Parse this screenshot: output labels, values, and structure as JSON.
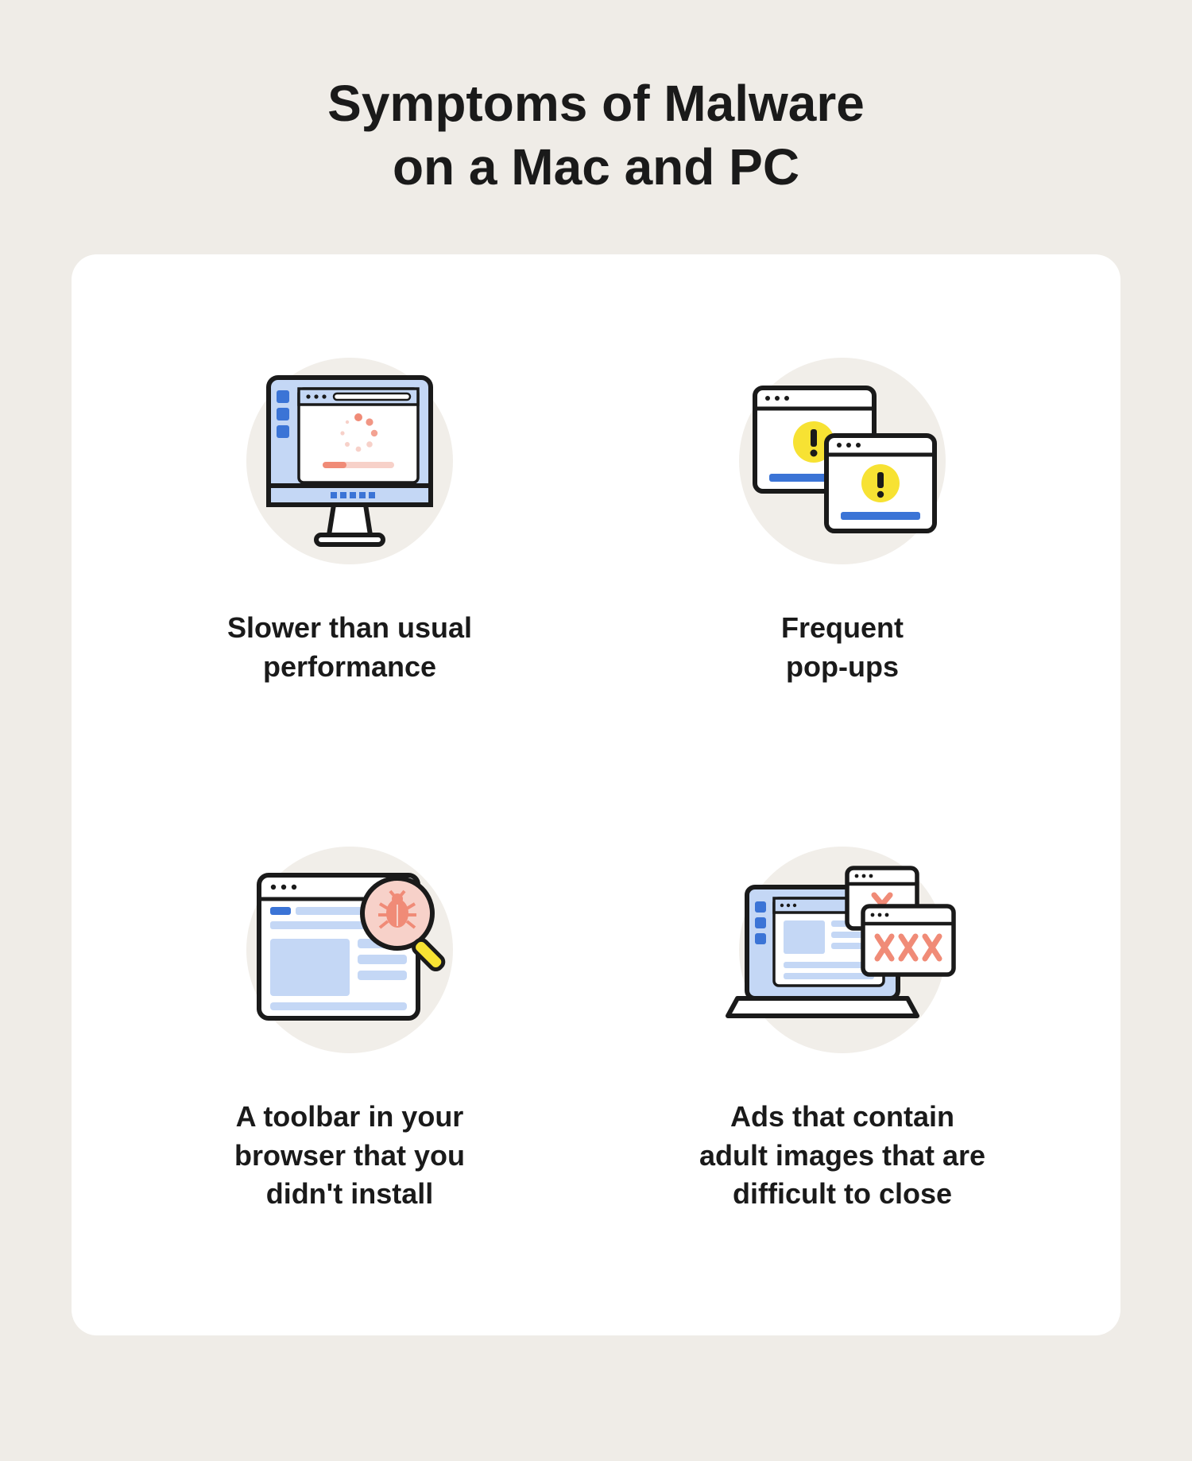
{
  "title_line1": "Symptoms of Malware",
  "title_line2": "on a Mac and PC",
  "items": [
    {
      "label": "Slower than usual\nperformance",
      "icon": "slow-computer-icon"
    },
    {
      "label": "Frequent\npop-ups",
      "icon": "popups-icon"
    },
    {
      "label": "A toolbar in your\nbrowser that you\ndidn't install",
      "icon": "browser-toolbar-bug-icon"
    },
    {
      "label": "Ads that contain\nadult images that are\ndifficult to close",
      "icon": "laptop-ads-icon"
    }
  ],
  "colors": {
    "page_bg": "#efece7",
    "card_bg": "#ffffff",
    "circle_bg": "#f1eee9",
    "stroke": "#1a1a1a",
    "blue_light": "#c4d7f5",
    "blue": "#3b74d6",
    "yellow": "#f7e233",
    "salmon": "#f08b77",
    "salmon_light": "#f7d1c9"
  }
}
